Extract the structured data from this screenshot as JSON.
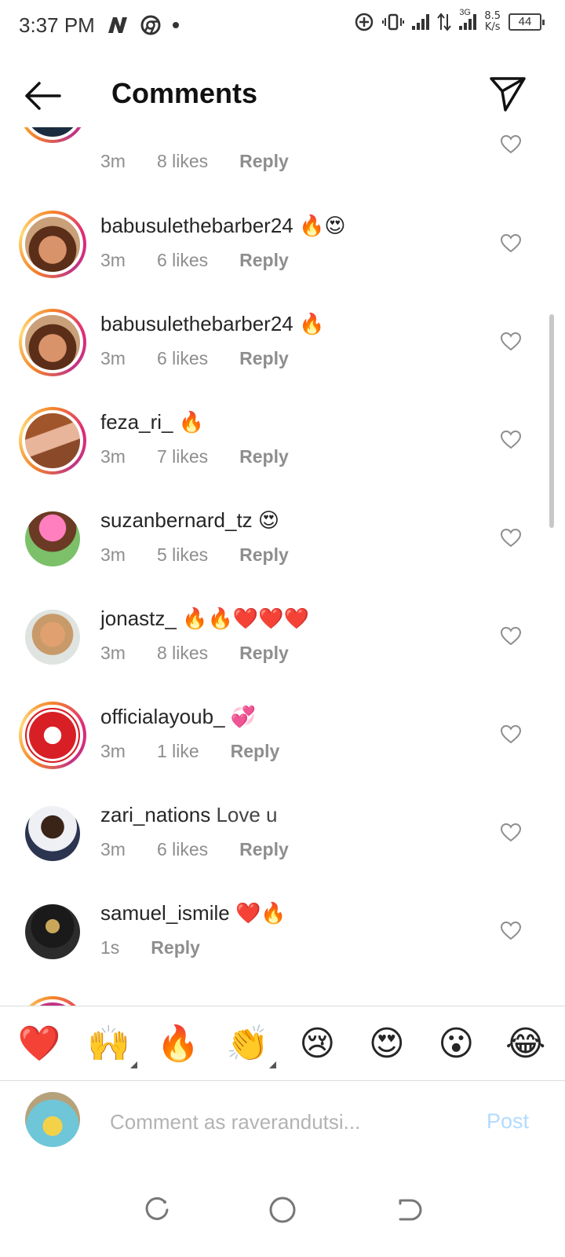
{
  "status_bar": {
    "time": "3:37 PM",
    "network_type": "3G",
    "speed_value": "8.5",
    "speed_unit": "K/s",
    "battery": "44"
  },
  "header": {
    "title": "Comments"
  },
  "comments": [
    {
      "user": "",
      "text": "",
      "time": "3m",
      "likes": "8 likes",
      "reply": "Reply"
    },
    {
      "user": "babusulethebarber24",
      "text": "🔥😍",
      "time": "3m",
      "likes": "6 likes",
      "reply": "Reply"
    },
    {
      "user": "babusulethebarber24",
      "text": "🔥",
      "time": "3m",
      "likes": "6 likes",
      "reply": "Reply"
    },
    {
      "user": "feza_ri_",
      "text": "🔥",
      "time": "3m",
      "likes": "7 likes",
      "reply": "Reply"
    },
    {
      "user": "suzanbernard_tz",
      "text": "😍",
      "time": "3m",
      "likes": "5 likes",
      "reply": "Reply"
    },
    {
      "user": "jonastz_",
      "text": "🔥🔥❤️❤️❤️",
      "time": "3m",
      "likes": "8 likes",
      "reply": "Reply"
    },
    {
      "user": "officialayoub_",
      "text": "💞",
      "time": "3m",
      "likes": "1 like",
      "reply": "Reply"
    },
    {
      "user": "zari_nations",
      "text": "Love u",
      "time": "3m",
      "likes": "6 likes",
      "reply": "Reply"
    },
    {
      "user": "samuel_ismile",
      "text": "❤️🔥",
      "time": "1s",
      "likes": "",
      "reply": "Reply"
    }
  ],
  "emoji_bar": [
    "❤️",
    "🙌",
    "🔥",
    "👏",
    "😢",
    "😍",
    "😮",
    "😂"
  ],
  "composer": {
    "placeholder": "Comment as raverandutsi...",
    "post_label": "Post"
  },
  "colors": {
    "accent_disabled": "#b3dbff",
    "meta_gray": "#8e8e8e",
    "story_ring": "#dd2a7b"
  }
}
